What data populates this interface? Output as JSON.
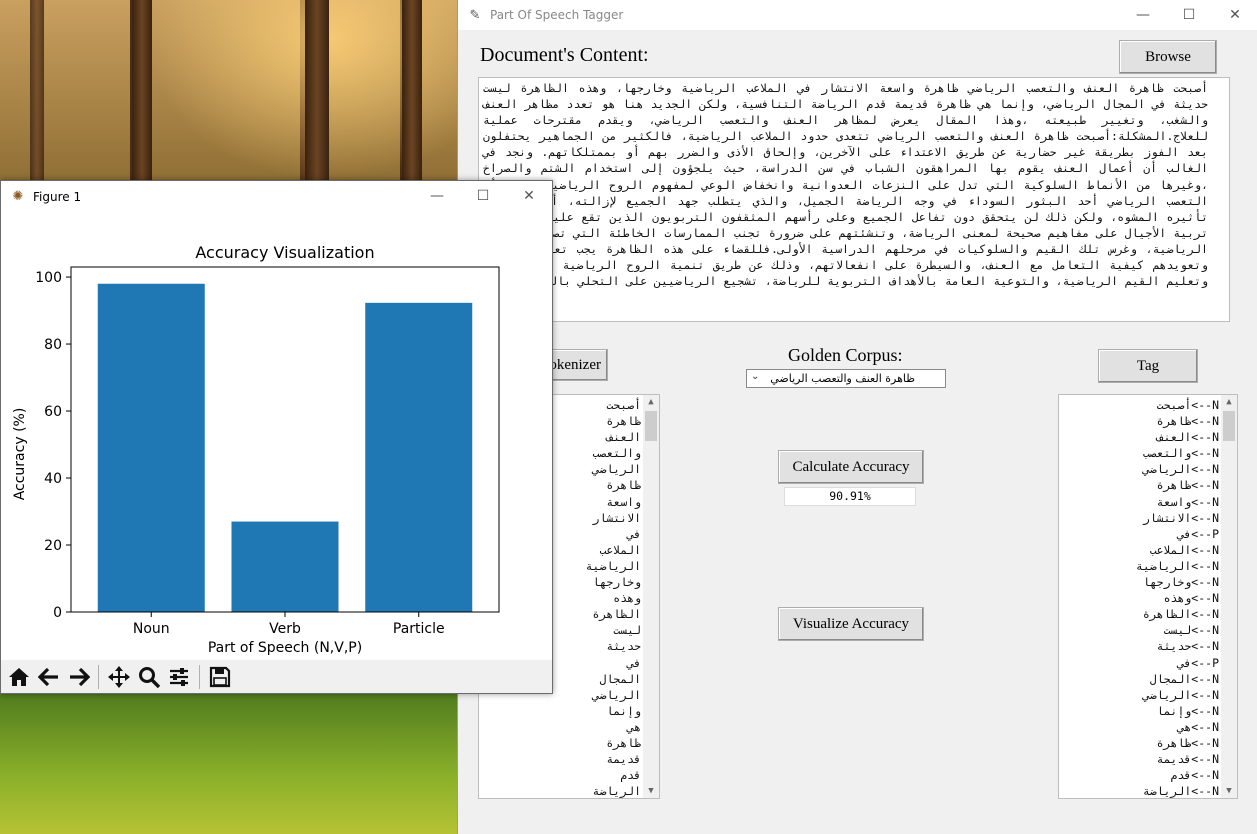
{
  "main_window": {
    "title": "Part Of Speech Tagger",
    "controls": {
      "minimize": "—",
      "maximize": "☐",
      "close": "✕"
    },
    "doc_label": "Document's Content:",
    "browse_label": "Browse",
    "document_text": "أصبحت ظاهرة العنف والتعصب الرياضي ظاهرة واسعة الانتشار في الملاعب الرياضية وخارجها، وهذه الظاهرة ليست حديثة في المجال الرياضي، وإنما هي ظاهرة قديمة قدم الرياضة التنافسية، ولكن الجديد هنا هو تعدد مظاهر العنف والشغب، وتغيير طبيعته ،وهذا المقال يعرض لمظاهر العنف والتعصب الرياضي، ويقدم مقترحات عملية للعلاج.المشكلة:أصبحت ظاهرة العنف والتعصب الرياضي تتعدى حدود الملاعب الرياضية، فالكثير من الجماهير يحتفلون بعد الفوز بطريقة غير حضارية عن طريق الاعتداء على الآخرين، وإلحاق الأذى والضرر بهم أو بممتلكاتهم. ونجد في الغالب أن أعمال العنف يقوم بها المراهقون الشباب في سن الدراسة، حيث يلجؤون إلى استخدام الشتم والصراخ ،وغيرها من الأنماط السلوكية التي تدل على النزعات العدوانية وانخفاض الوعي لمفهوم الروح الرياضية.العلاج:أن التعصب الرياضي أحد البثور السوداء في وجه الرياضة الجميل، والذي يتطلب جهد الجميع لإزالته، أو الحد من تأثيره المشوه، ولكن ذلك لن يتحقق دون تفاعل الجميع وعلى رأسهم المثقفون التربويون الذين تقع عليهم مسؤولية تربية الأجيال على مفاهيم صحيحة لمعنى الرياضة، وتنشئتهم على ضرورة تجنب الممارسات الخاطئة التي تصاحب الأنشطة الرياضية، وغرس تلك القيم والسلوكيات في مرحلهم الدراسية الأولى.فللقضاء على هذه الظاهرة يجب تعليم الأفراد وتعويدهم كيفية التعامل مع العنف، والسيطرة على انفعالاتهم، وذلك عن طريق تنمية الروح الرياضية لدى النشء، وتعليم القيم الرياضية، والتوعية العامة بالأهداف التربوية للرياضة، تشجيع الرياضيين على التحلي بالروح",
    "tokenizer_label": "Tokenizer",
    "golden_label": "Golden Corpus:",
    "corpus_selected": "ظاهرة العنف والتعصب الرياضي",
    "tag_label": "Tag",
    "calc_label": "Calculate Accuracy",
    "accuracy_value": "90.91%",
    "visualize_label": "Visualize Accuracy",
    "tokens": [
      "أصبحت",
      "ظاهرة",
      "العنف",
      "والتعصب",
      "الرياضي",
      "ظاهرة",
      "واسعة",
      "الانتشار",
      "في",
      "الملاعب",
      "الرياضية",
      "وخارجها",
      "وهذه",
      "الظاهرة",
      "ليست",
      "حديثة",
      "في",
      "المجال",
      "الرياضي",
      "وإنما",
      "هي",
      "ظاهرة",
      "قديمة",
      "قدم",
      "الرياضة"
    ],
    "tagged": [
      "N-->أصبحت",
      "N-->ظاهرة",
      "N-->العنف",
      "N-->والتعصب",
      "N-->الرياضي",
      "N-->ظاهرة",
      "N-->واسعة",
      "N-->الانتشار",
      "P-->في",
      "N-->الملاعب",
      "N-->الرياضية",
      "N-->وخارجها",
      "N-->وهذه",
      "N-->الظاهرة",
      "N-->ليست",
      "N-->حديثة",
      "P-->في",
      "N-->المجال",
      "N-->الرياضي",
      "N-->وإنما",
      "N-->هي",
      "N-->ظاهرة",
      "N-->قديمة",
      "N-->قدم",
      "N-->الرياضة"
    ]
  },
  "figure_window": {
    "title": "Figure 1",
    "controls": {
      "minimize": "—",
      "maximize": "☐",
      "close": "✕"
    },
    "toolbar": [
      "home-icon",
      "back-icon",
      "forward-icon",
      "pan-icon",
      "zoom-icon",
      "configure-icon",
      "save-icon"
    ]
  },
  "chart_data": {
    "type": "bar",
    "title": "Accuracy Visualization",
    "xlabel": "Part of Speech  (N,V,P)",
    "ylabel": "Accuracy  (%)",
    "categories": [
      "Noun",
      "Verb",
      "Particle"
    ],
    "values": [
      98,
      27,
      92.3
    ],
    "ylim": [
      0,
      103
    ],
    "yticks": [
      0,
      20,
      40,
      60,
      80,
      100
    ],
    "color": "#1f77b4"
  }
}
